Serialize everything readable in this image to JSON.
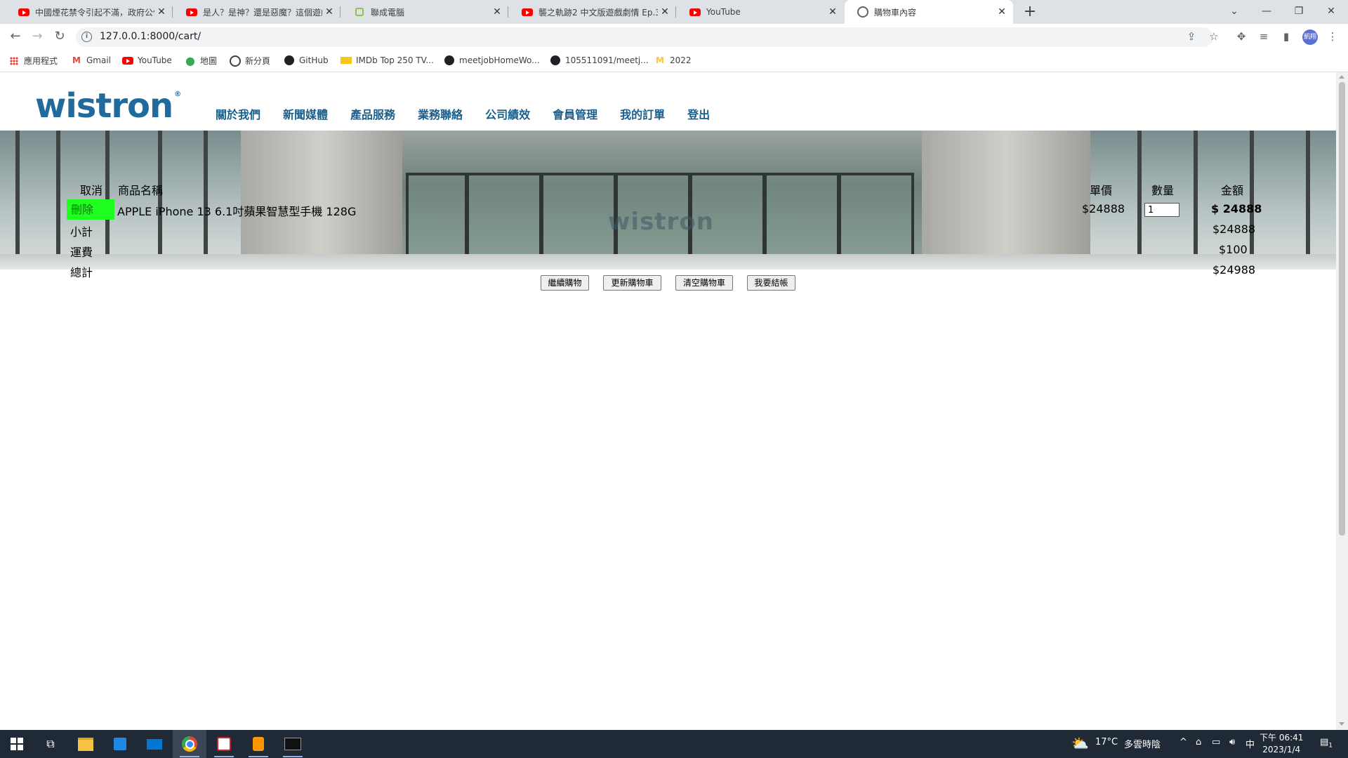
{
  "browser": {
    "tabs": [
      {
        "title": "中國煙花禁令引起不滿，政府公佈...",
        "icon": "youtube-icon",
        "active": false
      },
      {
        "title": "是人？是神？還是惡魔？這個遊戲...",
        "icon": "youtube-icon",
        "active": false
      },
      {
        "title": "聯成電腦",
        "icon": "lccnet-icon",
        "active": false
      },
      {
        "title": "襲之軌跡2 中文版遊戲劇情 Ep.3 ...",
        "icon": "youtube-icon",
        "active": false
      },
      {
        "title": "YouTube",
        "icon": "youtube-icon",
        "active": false
      },
      {
        "title": "購物車內容",
        "icon": "globe-icon",
        "active": true
      }
    ],
    "url": "127.0.0.1:8000/cart/",
    "profile_initials": "凱翔",
    "bookmarks": [
      {
        "label": "應用程式",
        "icon": "apps-icon"
      },
      {
        "label": "Gmail",
        "icon": "gmail-icon"
      },
      {
        "label": "YouTube",
        "icon": "youtube-icon"
      },
      {
        "label": "地圖",
        "icon": "maps-icon"
      },
      {
        "label": "新分頁",
        "icon": "globe-icon"
      },
      {
        "label": "GitHub",
        "icon": "github-icon"
      },
      {
        "label": "IMDb Top 250 TV...",
        "icon": "imdb-icon"
      },
      {
        "label": "meetjobHomeWo...",
        "icon": "github-icon"
      },
      {
        "label": "105511091/meetj...",
        "icon": "github-icon"
      },
      {
        "label": "2022",
        "icon": "mcdonalds-icon"
      }
    ]
  },
  "site": {
    "logo_text": "wistron",
    "logo_mark": "®",
    "nav": [
      "關於我們",
      "新聞媒體",
      "產品服務",
      "業務聯絡",
      "公司績效",
      "會員管理",
      "我的訂單",
      "登出"
    ],
    "banner_text": "wistron"
  },
  "cart": {
    "headers": {
      "cancel": "取消",
      "product": "商品名稱",
      "unit_price": "單價",
      "quantity": "數量",
      "amount": "金額"
    },
    "items": [
      {
        "delete_label": "刪除",
        "name": "APPLE iPhone 13 6.1吋蘋果智慧型手機 128G",
        "unit_price": "$24888",
        "quantity": "1",
        "amount": "$ 24888"
      }
    ],
    "subtotal_label": "小計",
    "subtotal": "$24888",
    "shipping_label": "運費",
    "shipping": "$100",
    "total_label": "總計",
    "total": "$24988",
    "actions": [
      "繼續購物",
      "更新購物車",
      "清空購物車",
      "我要結帳"
    ]
  },
  "taskbar": {
    "weather_temp": "17°C",
    "weather_desc": "多雲時陰",
    "ime": "中",
    "time": "下午 06:41",
    "date": "2023/1/4",
    "notifications": "1"
  }
}
